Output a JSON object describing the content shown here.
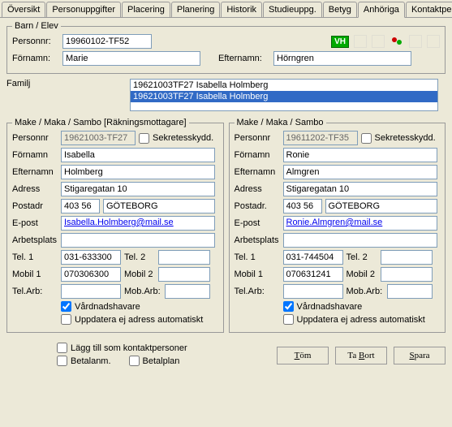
{
  "tabs": [
    "Översikt",
    "Personuppgifter",
    "Placering",
    "Planering",
    "Historik",
    "Studieuppg.",
    "Betyg",
    "Anhöriga",
    "Kontaktpersoner"
  ],
  "activeTab": "Anhöriga",
  "barn": {
    "legend": "Barn / Elev",
    "personnr_label": "Personnr:",
    "personnr": "19960102-TF52",
    "fornamn_label": "Förnamn:",
    "fornamn": "Marie",
    "efternamn_label": "Efternamn:",
    "efternamn": "Hörngren",
    "vh_badge": "VH"
  },
  "familj": {
    "label": "Familj",
    "item1": "19621003TF27  Isabella Holmberg",
    "item2": "19621003TF27  Isabella Holmberg"
  },
  "left": {
    "legend": "Make / Maka / Sambo [Räkningsmottagare]",
    "personnr_label": "Personnr",
    "personnr": "19621003-TF27",
    "sekretess_label": "Sekretesskydd.",
    "fornamn_label": "Förnamn",
    "fornamn": "Isabella",
    "efternamn_label": "Efternamn",
    "efternamn": "Holmberg",
    "adress_label": "Adress",
    "adress": "Stigaregatan 10",
    "postadr_label": "Postadr",
    "postnr": "403 56",
    "ort": "GÖTEBORG",
    "epost_label": "E-post",
    "epost": "Isabella.Holmberg@mail.se",
    "arbetsplats_label": "Arbetsplats",
    "arbetsplats": "",
    "tel1_label": "Tel. 1",
    "tel1": "031-633300",
    "tel2_label": "Tel. 2",
    "tel2": "",
    "mobil1_label": "Mobil 1",
    "mobil1": "070306300",
    "mobil2_label": "Mobil 2",
    "mobil2": "",
    "telarb_label": "Tel.Arb:",
    "telarb": "",
    "mobarb_label": "Mob.Arb:",
    "mobarb": "",
    "vardnad_label": "Vårdnadshavare",
    "uppdatera_label": "Uppdatera ej adress automatiskt"
  },
  "right": {
    "legend": "Make / Maka / Sambo",
    "personnr_label": "Personnr",
    "personnr": "19611202-TF35",
    "sekretess_label": "Sekretesskydd.",
    "fornamn_label": "Förnamn",
    "fornamn": "Ronie",
    "efternamn_label": "Efternamn",
    "efternamn": "Almgren",
    "adress_label": "Adress",
    "adress": "Stigaregatan 10",
    "postadr_label": "Postadr.",
    "postnr": "403 56",
    "ort": "GÖTEBORG",
    "epost_label": "E-post",
    "epost": "Ronie.Almgren@mail.se",
    "arbetsplats_label": "Arbetsplats",
    "arbetsplats": "",
    "tel1_label": "Tel. 1",
    "tel1": "031-744504",
    "tel2_label": "Tel. 2",
    "tel2": "",
    "mobil1_label": "Mobil 1",
    "mobil1": "070631241",
    "mobil2_label": "Mobil 2",
    "mobil2": "",
    "telarb_label": "Tel.Arb:",
    "telarb": "",
    "mobarb_label": "Mob.Arb:",
    "mobarb": "",
    "vardnad_label": "Vårdnadshavare",
    "uppdatera_label": "Uppdatera ej adress automatiskt"
  },
  "bottom": {
    "lagg_till_label": "Lägg till som kontaktpersoner",
    "betalanm_label": "Betalanm.",
    "betalplan_label": "Betalplan",
    "tom": "Töm",
    "tabort": "Ta Bort",
    "spara": "Spara"
  }
}
